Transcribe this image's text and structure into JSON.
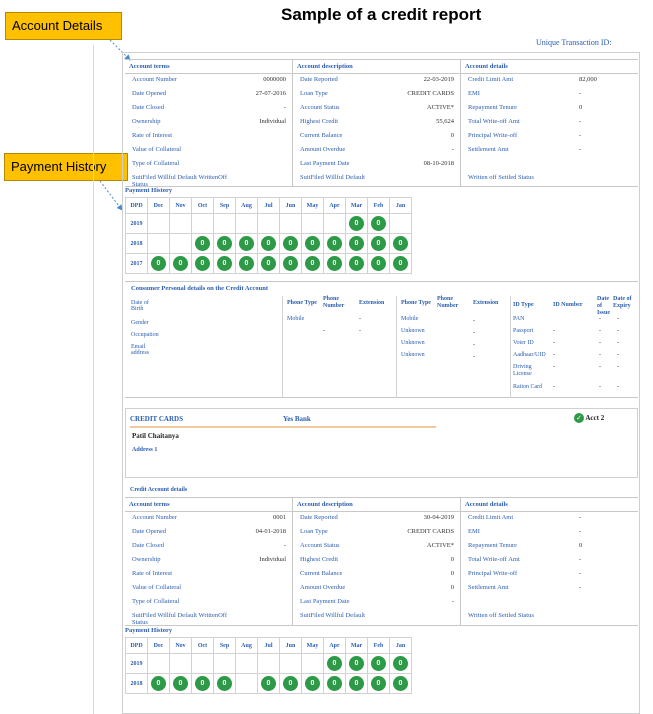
{
  "title": "Sample of a credit report",
  "transaction_label": "Unique Transaction ID:",
  "callouts": {
    "account_details": "Account Details",
    "payment_history": "Payment History"
  },
  "account1": {
    "col1_header": "Account terms",
    "col2_header": "Account description",
    "col3_header": "Account details",
    "terms": [
      {
        "label": "Account Number",
        "value": "0000000"
      },
      {
        "label": "Date Opened",
        "value": "27-07-2016"
      },
      {
        "label": "Date Closed",
        "value": "-"
      },
      {
        "label": "Ownership",
        "value": "Individual"
      },
      {
        "label": "Rate of Interest",
        "value": ""
      },
      {
        "label": "Value of Collateral",
        "value": ""
      },
      {
        "label": "Type of Collateral",
        "value": ""
      },
      {
        "label": "SuitFiled Willful Default WrittenOff Status",
        "value": ""
      }
    ],
    "description": [
      {
        "label": "Date Reported",
        "value": "22-03-2019"
      },
      {
        "label": "Loan Type",
        "value": "CREDIT CARDS"
      },
      {
        "label": "Account Status",
        "value": "ACTIVE*"
      },
      {
        "label": "Highest Credit",
        "value": "55,624"
      },
      {
        "label": "Current Balance",
        "value": "0"
      },
      {
        "label": "Amount Overdue",
        "value": "-"
      },
      {
        "label": "Last Payment Date",
        "value": "08-10-2018"
      },
      {
        "label": "SuitFiled Willful Default",
        "value": ""
      }
    ],
    "details": [
      {
        "label": "Credit Limit Amt",
        "value": "82,000"
      },
      {
        "label": "EMI",
        "value": "-"
      },
      {
        "label": "Repayment Tenure",
        "value": "0"
      },
      {
        "label": "Total Write-off Amt",
        "value": "-"
      },
      {
        "label": "Principal Write-off",
        "value": "-"
      },
      {
        "label": "Settlement Amt",
        "value": "-"
      },
      {
        "label": "",
        "value": ""
      },
      {
        "label": "Written off Settled Status",
        "value": ""
      }
    ]
  },
  "payment_history_1": {
    "title": "Payment History",
    "corner": "DPD",
    "months": [
      "Dec",
      "Nov",
      "Oct",
      "Sep",
      "Aug",
      "Jul",
      "Jun",
      "May",
      "Apr",
      "Mar",
      "Feb",
      "Jan"
    ],
    "rows": [
      {
        "year": "2019",
        "cells": [
          "",
          "",
          "",
          "",
          "",
          "",
          "",
          "",
          "",
          "0",
          "0",
          ""
        ]
      },
      {
        "year": "2018",
        "cells": [
          "",
          "",
          "0",
          "0",
          "0",
          "0",
          "0",
          "0",
          "0",
          "0",
          "0",
          "0"
        ]
      },
      {
        "year": "2017",
        "cells": [
          "0",
          "0",
          "0",
          "0",
          "0",
          "0",
          "0",
          "0",
          "0",
          "0",
          "0",
          "0"
        ]
      }
    ]
  },
  "personal": {
    "title": "Consumer Personal details on the Credit Account",
    "fields": [
      "Date of Birth",
      "Gender",
      "Occupation",
      "Email address"
    ],
    "phones_a": {
      "headers": [
        "Phone Type",
        "Phone Number",
        "Extension"
      ],
      "rows": [
        {
          "type": "Mobile",
          "number": "",
          "ext": "-"
        },
        {
          "type": "",
          "number": "-",
          "ext": "-"
        }
      ]
    },
    "phones_b": {
      "headers": [
        "Phone Type",
        "Phone Number",
        "Extension"
      ],
      "rows": [
        {
          "type": "Mobile",
          "number": "",
          "ext": "-"
        },
        {
          "type": "Unknown",
          "number": "",
          "ext": "-"
        },
        {
          "type": "Unknown",
          "number": "",
          "ext": "-"
        },
        {
          "type": "Unknown",
          "number": "",
          "ext": "-"
        }
      ]
    },
    "ids": {
      "headers": [
        "ID Type",
        "ID Number",
        "Date of Issue",
        "Date of Expiry"
      ],
      "rows": [
        {
          "type": "PAN",
          "number": "",
          "issue": "-",
          "expiry": "-"
        },
        {
          "type": "Passport",
          "number": "-",
          "issue": "-",
          "expiry": "-"
        },
        {
          "type": "Voter ID",
          "number": "-",
          "issue": "-",
          "expiry": "-"
        },
        {
          "type": "Aadhaar/UID",
          "number": "-",
          "issue": "-",
          "expiry": "-"
        },
        {
          "type": "Driving License",
          "number": "-",
          "issue": "-",
          "expiry": "-"
        },
        {
          "type": "Ration Card",
          "number": "-",
          "issue": "-",
          "expiry": "-"
        }
      ]
    }
  },
  "credit_card": {
    "type": "CREDIT CARDS",
    "bank": "Yes Bank",
    "acct": "Acct 2",
    "holder": "Patil Chaitanya",
    "address_label": "Address 1",
    "check_icon": "check-circle-icon"
  },
  "account2": {
    "section_title": "Credit Account details",
    "col1_header": "Account terms",
    "col2_header": "Account description",
    "col3_header": "Account details",
    "terms": [
      {
        "label": "Account Number",
        "value": "0001"
      },
      {
        "label": "Date Opened",
        "value": "04-01-2018"
      },
      {
        "label": "Date Closed",
        "value": "-"
      },
      {
        "label": "Ownership",
        "value": "Individual"
      },
      {
        "label": "Rate of Interest",
        "value": ""
      },
      {
        "label": "Value of Collateral",
        "value": ""
      },
      {
        "label": "Type of Collateral",
        "value": ""
      },
      {
        "label": "SuitFiled Willful Default WrittenOff Status",
        "value": ""
      }
    ],
    "description": [
      {
        "label": "Date Reported",
        "value": "30-04-2019"
      },
      {
        "label": "Loan Type",
        "value": "CREDIT CARDS"
      },
      {
        "label": "Account Status",
        "value": "ACTIVE*"
      },
      {
        "label": "Highest Credit",
        "value": "0"
      },
      {
        "label": "Current Balance",
        "value": "0"
      },
      {
        "label": "Amount Overdue",
        "value": "0"
      },
      {
        "label": "Last Payment Date",
        "value": "-"
      },
      {
        "label": "SuitFiled Willful Default",
        "value": ""
      }
    ],
    "details": [
      {
        "label": "Credit Limit Amt",
        "value": "-"
      },
      {
        "label": "EMI",
        "value": "-"
      },
      {
        "label": "Repayment Tenure",
        "value": "0"
      },
      {
        "label": "Total Write-off Amt",
        "value": "-"
      },
      {
        "label": "Principal Write-off",
        "value": "-"
      },
      {
        "label": "Settlement Amt",
        "value": "-"
      },
      {
        "label": "",
        "value": ""
      },
      {
        "label": "Written off Settled Status",
        "value": ""
      }
    ]
  },
  "payment_history_2": {
    "title": "Payment History",
    "corner": "DPD",
    "months": [
      "Dec",
      "Nov",
      "Oct",
      "Sep",
      "Aug",
      "Jul",
      "Jun",
      "May",
      "Apr",
      "Mar",
      "Feb",
      "Jan"
    ],
    "rows": [
      {
        "year": "2019",
        "cells": [
          "",
          "",
          "",
          "",
          "",
          "",
          "",
          "",
          "0",
          "0",
          "0",
          "0"
        ]
      },
      {
        "year": "2018",
        "cells": [
          "0",
          "0",
          "0",
          "0",
          "",
          "0",
          "0",
          "0",
          "0",
          "0",
          "0",
          "0"
        ]
      }
    ]
  },
  "colors": {
    "accent_blue": "#2a5db0",
    "ok_green": "#2e9a47",
    "callout_yellow": "#ffc000"
  }
}
